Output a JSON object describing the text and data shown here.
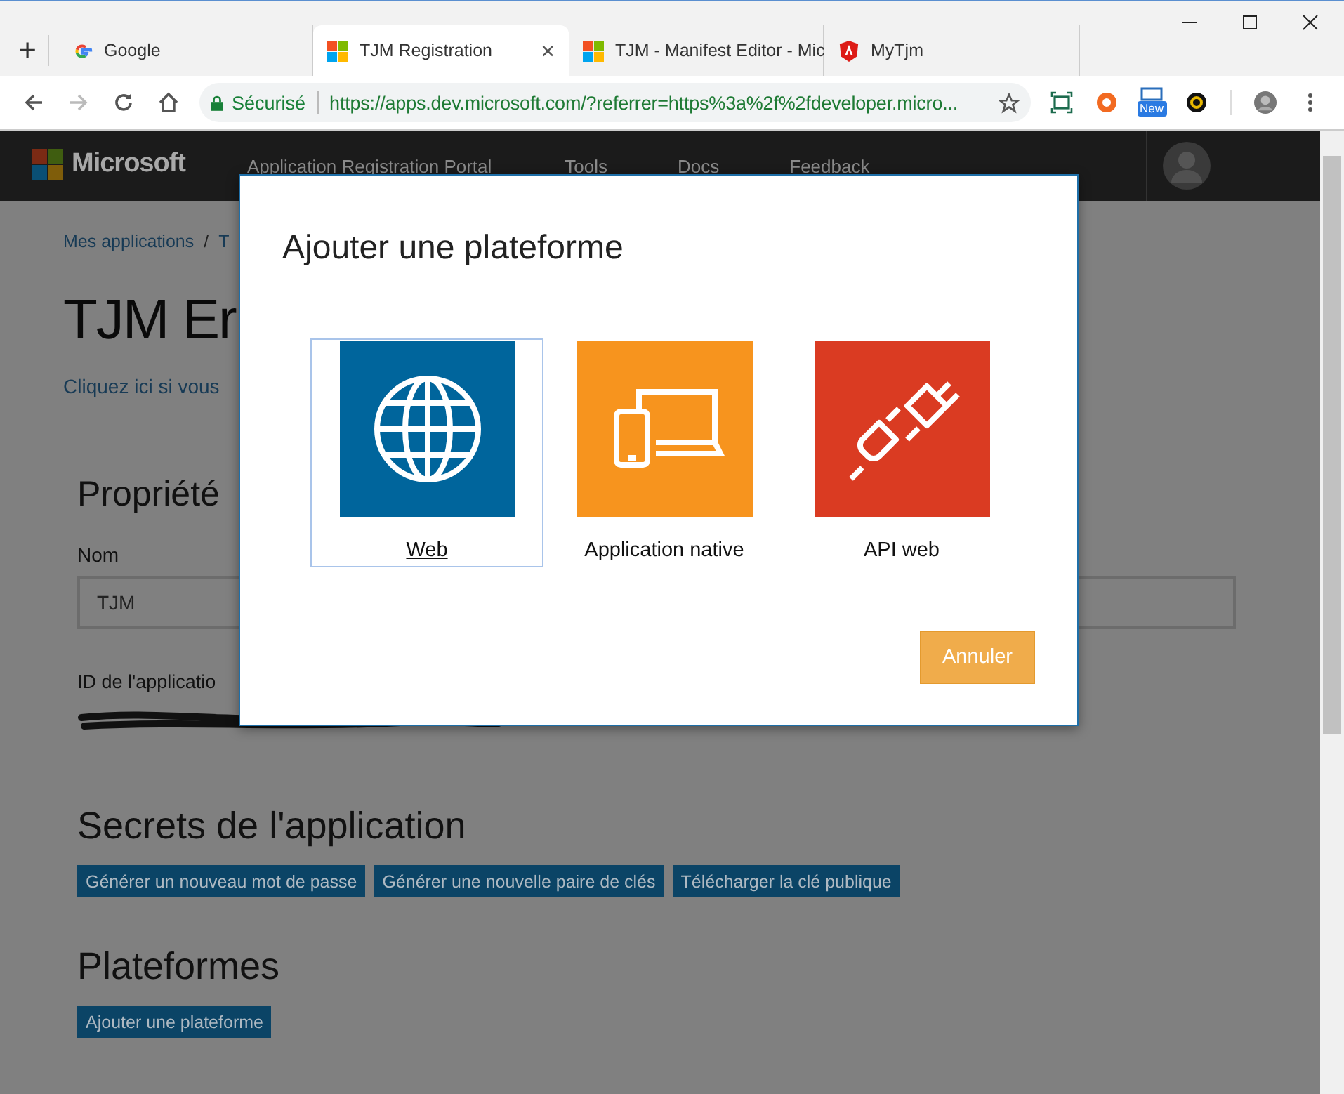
{
  "browser": {
    "tabs": [
      {
        "title": "Google",
        "kind": "g",
        "selected": false
      },
      {
        "title": "TJM Registration",
        "kind": "squares",
        "selected": true,
        "close": "×"
      },
      {
        "title": "TJM - Manifest Editor - Mic",
        "kind": "squares",
        "selected": false
      },
      {
        "title": "MyTjm",
        "kind": "shield",
        "selected": false
      }
    ],
    "new_tab": "+",
    "security": "Sécurisé",
    "url": "https://apps.dev.microsoft.com/?referrer=https%3a%2f%2fdeveloper.micro...",
    "extension_badge": "New",
    "forward_disabled": true
  },
  "header": {
    "brand": "Microsoft",
    "nav": [
      "Application Registration Portal",
      "Tools",
      "Docs",
      "Feedback"
    ]
  },
  "page": {
    "breadcrumb": "Mes applications",
    "breadcrumb_separator": "/",
    "breadcrumb_current": "T",
    "title": "TJM Er",
    "link": "Cliquez ici si vous",
    "properties": {
      "heading": "Propriété",
      "name_label": "Nom",
      "name_value": "TJM",
      "id_label": "ID de l'applicatio"
    },
    "secrets": {
      "heading": "Secrets de l'application",
      "buttons": [
        "Générer un nouveau mot de passe",
        "Générer une nouvelle paire de clés",
        "Télécharger la clé publique"
      ]
    },
    "platforms": {
      "heading": "Plateformes",
      "button": "Ajouter une plateforme"
    }
  },
  "dialog": {
    "title": "Ajouter une plateforme",
    "options": [
      {
        "label": "Web",
        "kind": "web",
        "color": "#00659c",
        "selected": true
      },
      {
        "label": "Application native",
        "kind": "native",
        "color": "#f7941e",
        "selected": false
      },
      {
        "label": "API web",
        "kind": "api",
        "color": "#da3b22",
        "selected": false
      }
    ],
    "cancel": "Annuler"
  }
}
